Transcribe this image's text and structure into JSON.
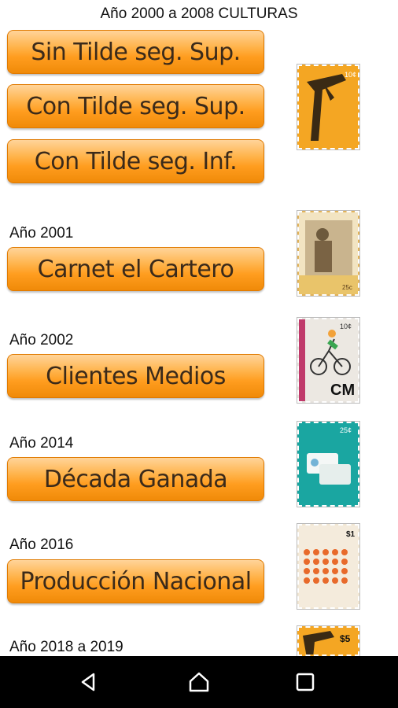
{
  "header": {
    "title": "Año 2000 a 2008 CULTURAS"
  },
  "sections": [
    {
      "buttons": [
        "Sin Tilde seg. Sup.",
        "Con Tilde seg. Sup.",
        "Con Tilde seg. Inf."
      ]
    },
    {
      "year": "Año 2001",
      "buttons": [
        "Carnet el Cartero"
      ]
    },
    {
      "year": "Año 2002",
      "buttons": [
        "Clientes Medios"
      ]
    },
    {
      "year": "Año 2014",
      "buttons": [
        "Década Ganada"
      ]
    },
    {
      "year": "Año 2016",
      "buttons": [
        "Producción Nacional"
      ]
    },
    {
      "year": "Año 2018 a 2019"
    }
  ],
  "stamps": [
    {
      "value": "10¢",
      "color": "#f4a623"
    },
    {
      "value": "25c",
      "color": "#e2b35a"
    },
    {
      "value": "10¢",
      "value2": "CM",
      "color": "#d9d5d0"
    },
    {
      "value": "25¢",
      "color": "#1aa6a1"
    },
    {
      "value": "$1",
      "color": "#f1e6d2"
    },
    {
      "value": "$5",
      "color": "#f4a623"
    }
  ],
  "navbar": {
    "icons": [
      "back-icon",
      "home-icon",
      "recents-icon"
    ]
  }
}
